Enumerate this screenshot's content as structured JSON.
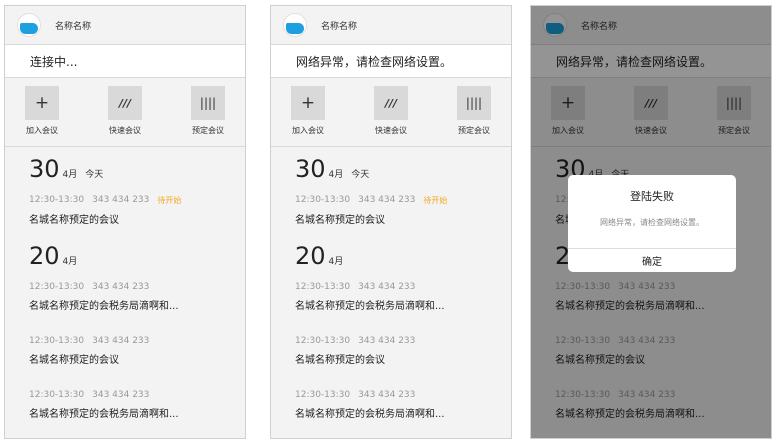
{
  "app_name": "名称名称",
  "screens": [
    {
      "status": "连接中..."
    },
    {
      "status": "网络异常，请检查网络设置。"
    },
    {
      "status": "网络异常，请检查网络设置。"
    }
  ],
  "actions": {
    "join": "加入会议",
    "quick": "快速会议",
    "schedule": "预定会议"
  },
  "icons": {
    "join": "+",
    "quick": "///",
    "schedule": "||||"
  },
  "groups": [
    {
      "day": "30",
      "month": "4月",
      "today": "今天",
      "meetings": [
        {
          "time": "12:30-13:30",
          "id": "343 434 233",
          "badge": "待开始",
          "title": "名城名称预定的会议"
        }
      ]
    },
    {
      "day": "20",
      "month": "4月",
      "meetings": [
        {
          "time": "12:30-13:30",
          "id": "343 434 233",
          "title": "名城名称预定的会税务局滴啊和..."
        },
        {
          "time": "12:30-13:30",
          "id": "343 434 233",
          "title": "名城名称预定的会议"
        },
        {
          "time": "12:30-13:30",
          "id": "343 434 233",
          "title": "名城名称预定的会税务局滴啊和..."
        }
      ]
    }
  ],
  "dialog": {
    "title": "登陆失败",
    "message": "网络异常，请检查网络设置。",
    "confirm": "确定"
  },
  "colors": {
    "badge": "#f5a623",
    "logo": "#1ea0e0",
    "panel": "#f3f3f3"
  }
}
